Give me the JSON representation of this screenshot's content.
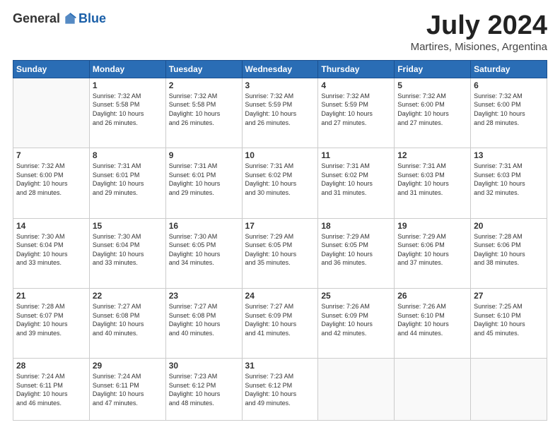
{
  "logo": {
    "general": "General",
    "blue": "Blue"
  },
  "header": {
    "month": "July 2024",
    "location": "Martires, Misiones, Argentina"
  },
  "weekdays": [
    "Sunday",
    "Monday",
    "Tuesday",
    "Wednesday",
    "Thursday",
    "Friday",
    "Saturday"
  ],
  "weeks": [
    [
      {
        "day": "",
        "info": ""
      },
      {
        "day": "1",
        "info": "Sunrise: 7:32 AM\nSunset: 5:58 PM\nDaylight: 10 hours\nand 26 minutes."
      },
      {
        "day": "2",
        "info": "Sunrise: 7:32 AM\nSunset: 5:58 PM\nDaylight: 10 hours\nand 26 minutes."
      },
      {
        "day": "3",
        "info": "Sunrise: 7:32 AM\nSunset: 5:59 PM\nDaylight: 10 hours\nand 26 minutes."
      },
      {
        "day": "4",
        "info": "Sunrise: 7:32 AM\nSunset: 5:59 PM\nDaylight: 10 hours\nand 27 minutes."
      },
      {
        "day": "5",
        "info": "Sunrise: 7:32 AM\nSunset: 6:00 PM\nDaylight: 10 hours\nand 27 minutes."
      },
      {
        "day": "6",
        "info": "Sunrise: 7:32 AM\nSunset: 6:00 PM\nDaylight: 10 hours\nand 28 minutes."
      }
    ],
    [
      {
        "day": "7",
        "info": "Sunrise: 7:32 AM\nSunset: 6:00 PM\nDaylight: 10 hours\nand 28 minutes."
      },
      {
        "day": "8",
        "info": "Sunrise: 7:31 AM\nSunset: 6:01 PM\nDaylight: 10 hours\nand 29 minutes."
      },
      {
        "day": "9",
        "info": "Sunrise: 7:31 AM\nSunset: 6:01 PM\nDaylight: 10 hours\nand 29 minutes."
      },
      {
        "day": "10",
        "info": "Sunrise: 7:31 AM\nSunset: 6:02 PM\nDaylight: 10 hours\nand 30 minutes."
      },
      {
        "day": "11",
        "info": "Sunrise: 7:31 AM\nSunset: 6:02 PM\nDaylight: 10 hours\nand 31 minutes."
      },
      {
        "day": "12",
        "info": "Sunrise: 7:31 AM\nSunset: 6:03 PM\nDaylight: 10 hours\nand 31 minutes."
      },
      {
        "day": "13",
        "info": "Sunrise: 7:31 AM\nSunset: 6:03 PM\nDaylight: 10 hours\nand 32 minutes."
      }
    ],
    [
      {
        "day": "14",
        "info": "Sunrise: 7:30 AM\nSunset: 6:04 PM\nDaylight: 10 hours\nand 33 minutes."
      },
      {
        "day": "15",
        "info": "Sunrise: 7:30 AM\nSunset: 6:04 PM\nDaylight: 10 hours\nand 33 minutes."
      },
      {
        "day": "16",
        "info": "Sunrise: 7:30 AM\nSunset: 6:05 PM\nDaylight: 10 hours\nand 34 minutes."
      },
      {
        "day": "17",
        "info": "Sunrise: 7:29 AM\nSunset: 6:05 PM\nDaylight: 10 hours\nand 35 minutes."
      },
      {
        "day": "18",
        "info": "Sunrise: 7:29 AM\nSunset: 6:05 PM\nDaylight: 10 hours\nand 36 minutes."
      },
      {
        "day": "19",
        "info": "Sunrise: 7:29 AM\nSunset: 6:06 PM\nDaylight: 10 hours\nand 37 minutes."
      },
      {
        "day": "20",
        "info": "Sunrise: 7:28 AM\nSunset: 6:06 PM\nDaylight: 10 hours\nand 38 minutes."
      }
    ],
    [
      {
        "day": "21",
        "info": "Sunrise: 7:28 AM\nSunset: 6:07 PM\nDaylight: 10 hours\nand 39 minutes."
      },
      {
        "day": "22",
        "info": "Sunrise: 7:27 AM\nSunset: 6:08 PM\nDaylight: 10 hours\nand 40 minutes."
      },
      {
        "day": "23",
        "info": "Sunrise: 7:27 AM\nSunset: 6:08 PM\nDaylight: 10 hours\nand 40 minutes."
      },
      {
        "day": "24",
        "info": "Sunrise: 7:27 AM\nSunset: 6:09 PM\nDaylight: 10 hours\nand 41 minutes."
      },
      {
        "day": "25",
        "info": "Sunrise: 7:26 AM\nSunset: 6:09 PM\nDaylight: 10 hours\nand 42 minutes."
      },
      {
        "day": "26",
        "info": "Sunrise: 7:26 AM\nSunset: 6:10 PM\nDaylight: 10 hours\nand 44 minutes."
      },
      {
        "day": "27",
        "info": "Sunrise: 7:25 AM\nSunset: 6:10 PM\nDaylight: 10 hours\nand 45 minutes."
      }
    ],
    [
      {
        "day": "28",
        "info": "Sunrise: 7:24 AM\nSunset: 6:11 PM\nDaylight: 10 hours\nand 46 minutes."
      },
      {
        "day": "29",
        "info": "Sunrise: 7:24 AM\nSunset: 6:11 PM\nDaylight: 10 hours\nand 47 minutes."
      },
      {
        "day": "30",
        "info": "Sunrise: 7:23 AM\nSunset: 6:12 PM\nDaylight: 10 hours\nand 48 minutes."
      },
      {
        "day": "31",
        "info": "Sunrise: 7:23 AM\nSunset: 6:12 PM\nDaylight: 10 hours\nand 49 minutes."
      },
      {
        "day": "",
        "info": ""
      },
      {
        "day": "",
        "info": ""
      },
      {
        "day": "",
        "info": ""
      }
    ]
  ]
}
